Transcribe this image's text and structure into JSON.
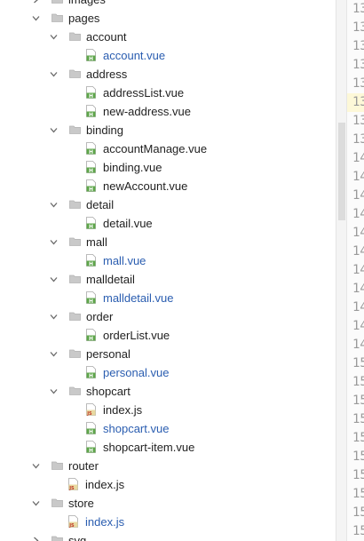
{
  "tree": [
    {
      "label": "images",
      "depth": 1,
      "type": "folder",
      "expanded": false,
      "cut": true
    },
    {
      "label": "pages",
      "depth": 1,
      "type": "folder",
      "expanded": true
    },
    {
      "label": "account",
      "depth": 2,
      "type": "folder",
      "expanded": true
    },
    {
      "label": "account.vue",
      "depth": 3,
      "type": "vue",
      "color": "blue"
    },
    {
      "label": "address",
      "depth": 2,
      "type": "folder",
      "expanded": true
    },
    {
      "label": "addressList.vue",
      "depth": 3,
      "type": "vue"
    },
    {
      "label": "new-address.vue",
      "depth": 3,
      "type": "vue"
    },
    {
      "label": "binding",
      "depth": 2,
      "type": "folder",
      "expanded": true
    },
    {
      "label": "accountManage.vue",
      "depth": 3,
      "type": "vue"
    },
    {
      "label": "binding.vue",
      "depth": 3,
      "type": "vue"
    },
    {
      "label": "newAccount.vue",
      "depth": 3,
      "type": "vue"
    },
    {
      "label": "detail",
      "depth": 2,
      "type": "folder",
      "expanded": true
    },
    {
      "label": "detail.vue",
      "depth": 3,
      "type": "vue"
    },
    {
      "label": "mall",
      "depth": 2,
      "type": "folder",
      "expanded": true
    },
    {
      "label": "mall.vue",
      "depth": 3,
      "type": "vue",
      "color": "blue"
    },
    {
      "label": "malldetail",
      "depth": 2,
      "type": "folder",
      "expanded": true
    },
    {
      "label": "malldetail.vue",
      "depth": 3,
      "type": "vue",
      "color": "blue"
    },
    {
      "label": "order",
      "depth": 2,
      "type": "folder",
      "expanded": true
    },
    {
      "label": "orderList.vue",
      "depth": 3,
      "type": "vue"
    },
    {
      "label": "personal",
      "depth": 2,
      "type": "folder",
      "expanded": true
    },
    {
      "label": "personal.vue",
      "depth": 3,
      "type": "vue",
      "color": "blue"
    },
    {
      "label": "shopcart",
      "depth": 2,
      "type": "folder",
      "expanded": true
    },
    {
      "label": "index.js",
      "depth": 3,
      "type": "js"
    },
    {
      "label": "shopcart.vue",
      "depth": 3,
      "type": "vue",
      "color": "blue"
    },
    {
      "label": "shopcart-item.vue",
      "depth": 3,
      "type": "vue"
    },
    {
      "label": "router",
      "depth": 1,
      "type": "folder",
      "expanded": true
    },
    {
      "label": "index.js",
      "depth": 2,
      "type": "js"
    },
    {
      "label": "store",
      "depth": 1,
      "type": "folder",
      "expanded": true
    },
    {
      "label": "index.js",
      "depth": 2,
      "type": "js",
      "color": "blue"
    },
    {
      "label": "svg",
      "depth": 1,
      "type": "folder",
      "expanded": false
    }
  ],
  "line_numbers": [
    "13",
    "13",
    "13",
    "13",
    "13",
    "13",
    "13",
    "13",
    "14",
    "14",
    "14",
    "14",
    "14",
    "14",
    "14",
    "14",
    "14",
    "14",
    "14",
    "15",
    "15",
    "15",
    "15",
    "15",
    "15",
    "15",
    "15",
    "15",
    "15"
  ],
  "current_line_row": 5,
  "colors": {
    "blue": "#2a5db0",
    "folder": "#c9c9c9",
    "vue_icon": "#5ea64a",
    "js_icon": "#e8d9a0",
    "selection": "#eef3fb"
  }
}
